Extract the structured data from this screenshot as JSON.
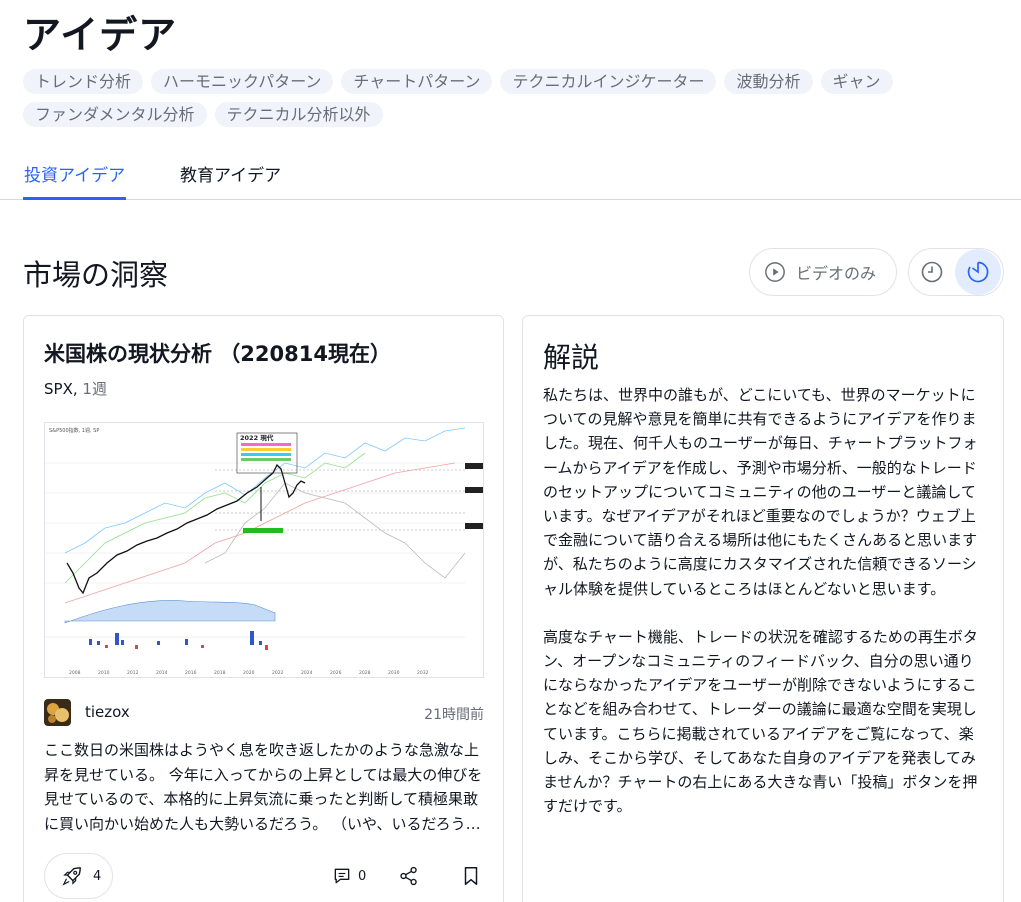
{
  "page": {
    "title": "アイデア"
  },
  "chips": [
    "トレンド分析",
    "ハーモニックパターン",
    "チャートパターン",
    "テクニカルインジケーター",
    "波動分析",
    "ギャン",
    "ファンダメンタル分析",
    "テクニカル分析以外"
  ],
  "tabs": {
    "active": "投資アイデア",
    "inactive": "教育アイデア"
  },
  "section": {
    "title": "市場の洞察",
    "video_only_label": "ビデオのみ"
  },
  "idea": {
    "title": "米国株の現状分析 （220814現在）",
    "symbol": "SPX,",
    "interval": "1週",
    "author": "tiezox",
    "time_ago": "21時間前",
    "description": "ここ数日の米国株はようやく息を吹き返したかのような急激な上昇を見せている。 今年に入ってからの上昇としては最大の伸びを見せているので、本格的に上昇気流に乗ったと判断して積極果敢に買い向かい始めた人も大勢いるだろう。 （いや、いるだろう…",
    "boosts": "4",
    "comments": "0",
    "chart_label": "S&P500指数, 1週, SP",
    "chart_annotation": "2022 現代",
    "chart_x_labels": [
      "2008",
      "2010",
      "2012",
      "2014",
      "2016",
      "2018",
      "2020",
      "2022",
      "2024",
      "2026",
      "2028",
      "2030",
      "2032"
    ]
  },
  "explain": {
    "title": "解説",
    "paragraphs": [
      "私たちは、世界中の誰もが、どこにいても、世界のマーケットについての見解や意見を簡単に共有できるようにアイデアを作りました。現在、何千人ものユーザーが毎日、チャートプラットフォームからアイデアを作成し、予測や市場分析、一般的なトレードのセットアップについてコミュニティの他のユーザーと議論しています。なぜアイデアがそれほど重要なのでしょうか？ウェブ上で金融について語り合える場所は他にもたくさんあると思いますが、私たちのように高度にカスタマイズされた信頼できるソーシャル体験を提供しているところはほとんどないと思います。",
      "高度なチャート機能、トレードの状況を確認するための再生ボタン、オープンなコミュニティのフィードバック、自分の思い通りにならなかったアイデアをユーザーが削除できないようにすることなどを組み合わせて、トレーダーの議論に最適な空間を実現しています。こちらに掲載されているアイデアをご覧になって、楽しみ、そこから学び、そしてあなた自身のアイデアを発表してみませんか？チャートの右上にある大きな青い「投稿」ボタンを押すだけです。"
    ]
  },
  "colors": {
    "accent": "#2962ff",
    "chip_bg": "#f0f3fa",
    "muted": "#6a6d78",
    "border": "#e0e3eb"
  }
}
